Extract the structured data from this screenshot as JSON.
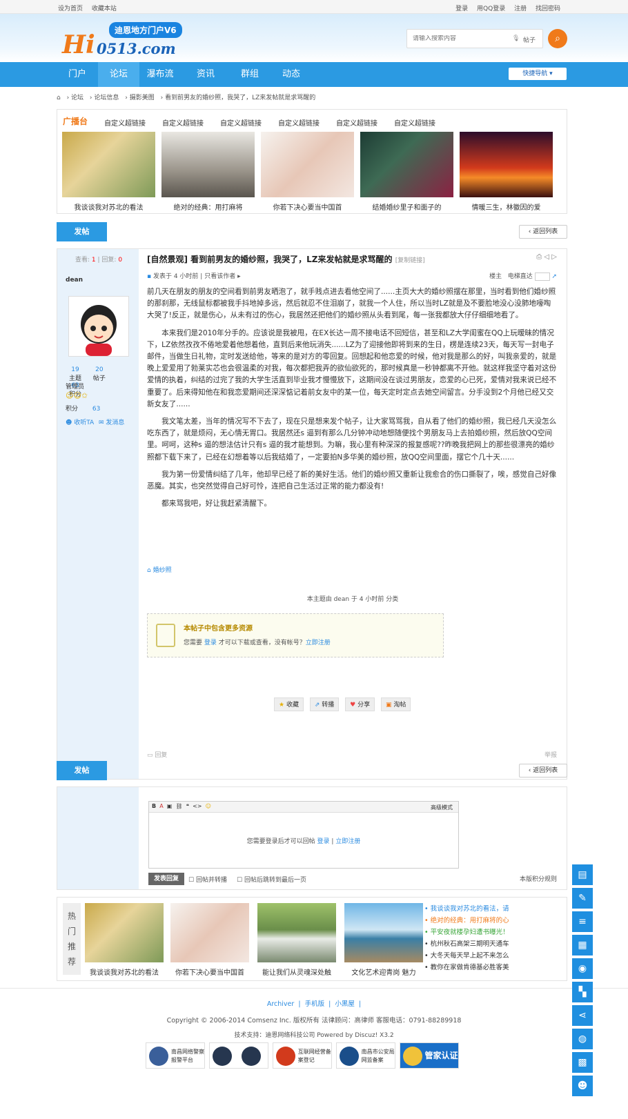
{
  "topbar": {
    "set_home": "设为首页",
    "bookmark": "收藏本站",
    "login": "登录",
    "qq_login": "用QQ登录",
    "register": "注册",
    "find_password": "找回密码"
  },
  "logo": {
    "hi": "Hi",
    "domain": "0513.com",
    "badge": "迪恩地方门户V6"
  },
  "search": {
    "placeholder": "请输入搜索内容",
    "type": "帖子"
  },
  "nav": {
    "items": [
      "门户",
      "论坛",
      "瀑布流",
      "资讯",
      "群组",
      "动态"
    ],
    "quick": "快捷导航"
  },
  "breadcrumb": [
    "论坛",
    "论坛信息",
    "摄影美图",
    "看到前男友的婚纱照，我哭了，LZ来发帖就是求骂醒的"
  ],
  "broadcast": {
    "title": "广播台",
    "links": [
      "自定义超链接",
      "自定义超链接",
      "自定义超链接",
      "自定义超链接",
      "自定义超链接",
      "自定义超链接"
    ],
    "captions": [
      "我谈谈我对苏北的看法",
      "绝对的经典：用打麻将",
      "你若下决心要当中国首",
      "结婚婚纱里子和面子的",
      "情暖三生，林徽因的爱"
    ]
  },
  "buttons": {
    "post": "发帖",
    "back": "返回列表"
  },
  "post": {
    "views_label": "查看:",
    "views": "1",
    "replies_label": "回复:",
    "replies": "0",
    "title": "[自然景观] 看到前男友的婚纱照，我哭了，LZ来发帖就是求骂醒的",
    "copy_link": "[复制链接]",
    "author": "dean",
    "posted": "发表于 4 小时前",
    "only_author": "只看该作者",
    "floor": "楼主",
    "jump": "电梯直达",
    "user_stats": [
      {
        "n": "19",
        "l": "主题"
      },
      {
        "n": "20",
        "l": "帖子"
      },
      {
        "n": "63",
        "l": "积分"
      }
    ],
    "role": "管理员",
    "credit_label": "积分",
    "credit": "63",
    "collect": "收听TA",
    "message": "发消息",
    "paragraphs": [
      "前几天在朋友的朋友的空间看到前男友晒泡了，就手贱点进去看他空间了......主页大大的婚纱照摆在那里，当时看到他们婚纱照的那刹那，无线鼠标都被我手抖地掉多远，然后就忍不住泪崩了，就我一个人住，所以当时LZ就是及不要脸地没心没肺地嚎啕大哭了!反正，就是伤心，从未有过的伤心，我居然还把他们的婚纱照从头看到尾，每一张我都放大仔仔细细地看了。",
      "　　本来我们是2010年分手的。应该说是我被甩，在EX长达一周不接电话不回短信，甚至和LZ大学闺蜜在QQ上玩暧昧的情况下，LZ依然孜孜不倦地爱着他想着他，直到后来他玩消失......LZ为了迎接他即将到来的生日，楞是连续23天，每天写一封电子邮件，当做生日礼物，定时发送给他，等来的是对方的零回复。回想起和他恋爱的时候，他对我是那么的好，叫我亲爱的，就是晚上爱爱用了勃莱实芯也会很温柔的对我，每次都把我弄的欲仙欲死的，那时候真是一秒钟都离不开他。就这样我坚守着对这份爱情的执着，纠结的过完了我的大学生活直到毕业我才慢慢放下，这期间没在谈过男朋友，恋爱的心已死，爱情对我来说已经不重要了。后来得知他在和我恋爱期间还深深惦记着前女友中的某一位，每天定时定点去她空间留言。分手没到2个月他已经又交新女友了......",
      "　　我文笔太差，当年的情况写不下去了，现在只是想来发个帖子，让大家骂骂我，自从看了他们的婚纱照，我已经几天没怎么吃东西了，就是烦闷，无心情无胃口。我居然还s 逼到有那么几分钟冲动地想随便找个男朋友马上去拍婚纱照，然后放QQ空间里。呵呵，这种s 逼的想法估计只有s 逼的我才能想到。为嘛，我心里有种深深的报复感呢??昨晚我把网上的那些很漂亮的婚纱照都下载下来了，已经在幻想着等以后我结婚了，一定要拍N多华美的婚纱照，放QQ空间里面，摆它个几十天......",
      "　　我为第一份爱情纠结了几年，他却早已经了新的美好生活。他们的婚纱照又重新让我愈合的伤口撕裂了，唉，感觉自己好像恶魔。其实，也突然觉得自己好可怜，连把自己生活过正常的能力都没有!",
      "　　都来骂我吧，好让我赶紧清醒下。"
    ],
    "tag": "婚纱照",
    "mod_note": "本主题由 dean 于 4 小时前 分类",
    "locked_title": "本帖子中包含更多资源",
    "locked_text_a": "您需要",
    "locked_login": "登录",
    "locked_text_b": "才可以下载或查看，没有帐号？",
    "locked_register": "立即注册",
    "actions": [
      "收藏",
      "转播",
      "分享",
      "淘帖"
    ],
    "reply": "回复",
    "report": "举报"
  },
  "editor": {
    "advanced": "高级模式",
    "need_login_a": "您需要登录后才可以回帖",
    "login": "登录",
    "register": "立即注册",
    "submit": "发表回复",
    "check1": "回帖并转播",
    "check2": "回帖后跳转到最后一页",
    "rule": "本版积分规则"
  },
  "hot": {
    "label": [
      "热",
      "门",
      "推",
      "荐"
    ],
    "captions": [
      "我谈谈我对苏北的看法",
      "你若下决心要当中国首",
      "能让我们从灵魂深处触",
      "文化艺术迎青岗 魅力"
    ],
    "list": [
      {
        "t": "我谈谈我对苏北的看法，请",
        "c": "#2b8be0"
      },
      {
        "t": "绝对的经典：用打麻将的心",
        "c": "#f07a1a"
      },
      {
        "t": "平安夜就楼孕妇遭书曝光！",
        "c": "#3aa63a"
      },
      {
        "t": "杭州秋石高架三期明天通车",
        "c": "#333333"
      },
      {
        "t": "大冬天每天早上起不来怎么",
        "c": "#333333"
      },
      {
        "t": "教你在家做肯德基必胜客美",
        "c": "#333333"
      }
    ]
  },
  "footer": {
    "links": [
      "Archiver",
      "手机版",
      "小黑屋"
    ],
    "copyright": "Copyright © 2006-2014   Comsenz Inc. 版权所有   法律顾问：高律师   客服电话：0791-88289918",
    "support": "技术支持：迪恩网络科技公司   Powered by Discuz! X3.2",
    "badges": [
      "南昌网络警察报警平台",
      "",
      "互联网经营备案登记",
      "南昌市公安局网监备案",
      "管家认证"
    ]
  }
}
